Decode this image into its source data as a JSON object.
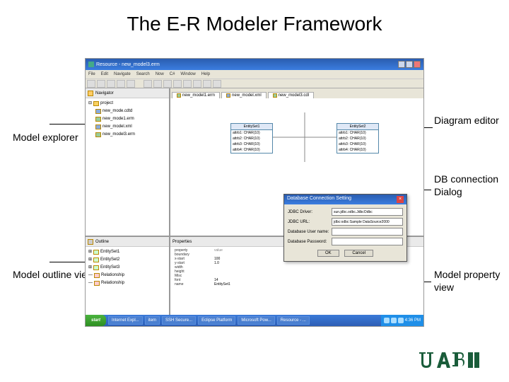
{
  "slide_title": "The E-R Modeler Framework",
  "annotations": {
    "model_explorer": "Model explorer",
    "diagram_editor": "Diagram editor",
    "db_dialog": "DB connection Dialog",
    "outline": "Model outline view",
    "property": "Model property view"
  },
  "window": {
    "title": "Resource - new_model3.erm",
    "menu": [
      "File",
      "Edit",
      "Navigate",
      "Search",
      "Now",
      "C#",
      "Window",
      "Help"
    ]
  },
  "navigator": {
    "tab": "Navigator",
    "root": "project",
    "items": [
      "new_mode.cdtd",
      "new_mode1.erm",
      "new_model.xml",
      "new_model3.erm"
    ]
  },
  "outline": {
    "tab": "Outline",
    "items": [
      "EntitySet1",
      "EntitySet2",
      "EntitySet3",
      "Relationship",
      "Relationship"
    ]
  },
  "editor": {
    "tabs": [
      "new_model1.erm",
      "new_model.xml",
      "new_model3.cdl"
    ],
    "ent1": {
      "name": "EntitySet1",
      "rows": [
        "attrb1: CHAR(10)",
        "attrb2: CHAR(10)",
        "attrb3: CHAR(10)",
        "attrb4: CHAR(10)"
      ]
    },
    "ent2": {
      "name": "EntitySet2",
      "rows": [
        "attrb1: CHAR(10)",
        "attrb2: CHAR(10)",
        "attrb3: CHAR(10)",
        "attrb4: CHAR(10)"
      ]
    }
  },
  "dialog": {
    "title": "Database Connection Setting",
    "driver_lbl": "JDBC Driver:",
    "driver_val": "sun.jdbc.odbc.JdbcOdbc",
    "url_lbl": "JDBC URL:",
    "url_val": "jdbc:odbc:Sample DataSource2000",
    "user_lbl": "Database User name:",
    "pass_lbl": "Database Password:",
    "ok": "OK",
    "cancel": "Cancel"
  },
  "props": {
    "tab": "Properties",
    "cols": [
      "property",
      "value"
    ],
    "rows": [
      [
        "boundary",
        ""
      ],
      [
        "  x-start",
        "100"
      ],
      [
        "  y-start",
        "1.0"
      ],
      [
        "  width",
        ""
      ],
      [
        "  height",
        ""
      ],
      [
        "Misc",
        ""
      ],
      [
        "  font",
        "14"
      ],
      [
        "name",
        "EntitySet1"
      ]
    ]
  },
  "taskbar": {
    "start": "start",
    "tasks": [
      "Internet Expl...",
      "item",
      "SSH Secure...",
      "Eclipse Platform",
      "Microsoft Pow...",
      "Resource - ..."
    ],
    "time": "4:36 PM"
  }
}
